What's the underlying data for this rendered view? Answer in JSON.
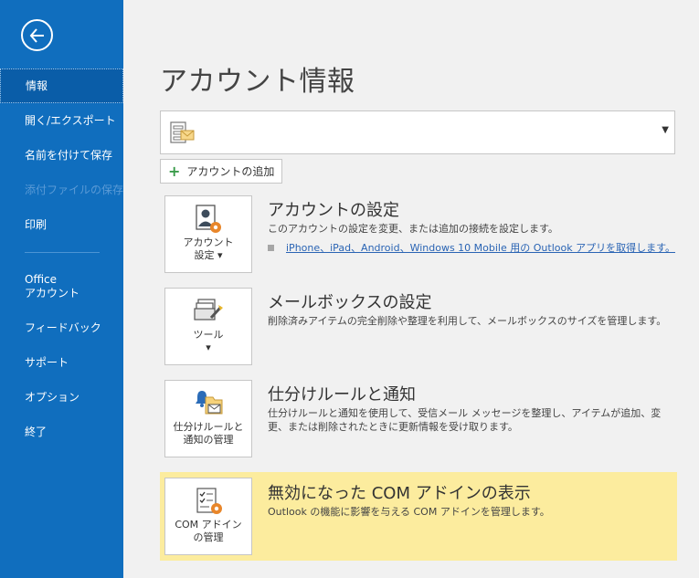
{
  "sidebar": {
    "back_icon": "back-arrow-icon",
    "items": [
      {
        "label": "情報"
      },
      {
        "label": "開く/エクスポート"
      },
      {
        "label": "名前を付けて保存"
      },
      {
        "label": "添付ファイルの保存"
      },
      {
        "label": "印刷"
      },
      {
        "label_line1": "Office",
        "label_line2": "アカウント"
      },
      {
        "label": "フィードバック"
      },
      {
        "label": "サポート"
      },
      {
        "label": "オプション"
      },
      {
        "label": "終了"
      }
    ]
  },
  "main": {
    "title": "アカウント情報",
    "account_select": {
      "icon": "mail-account-icon",
      "value": ""
    },
    "add_account_label": "アカウントの追加",
    "sections": [
      {
        "tile_line1": "アカウント",
        "tile_line2": "設定 ▾",
        "title": "アカウントの設定",
        "desc": "このアカウントの設定を変更、または追加の接続を設定します。",
        "link": "iPhone、iPad、Android、Windows 10 Mobile 用の Outlook アプリを取得します。"
      },
      {
        "tile_line1": "ツール",
        "tile_line2": "▾",
        "title": "メールボックスの設定",
        "desc": "削除済みアイテムの完全削除や整理を利用して、メールボックスのサイズを管理します。"
      },
      {
        "tile_line1": "仕分けルールと",
        "tile_line2": "通知の管理",
        "title": "仕分けルールと通知",
        "desc": "仕分けルールと通知を使用して、受信メール メッセージを整理し、アイテムが追加、変更、または削除されたときに更新情報を受け取ります。"
      },
      {
        "tile_line1": "COM アドイン",
        "tile_line2": "の管理",
        "title": "無効になった COM アドインの表示",
        "desc": "Outlook の機能に影響を与える COM アドインを管理します。"
      }
    ]
  },
  "colors": {
    "sidebar": "#106ebe",
    "highlight": "#fcec9e",
    "link": "#2a64b4"
  }
}
